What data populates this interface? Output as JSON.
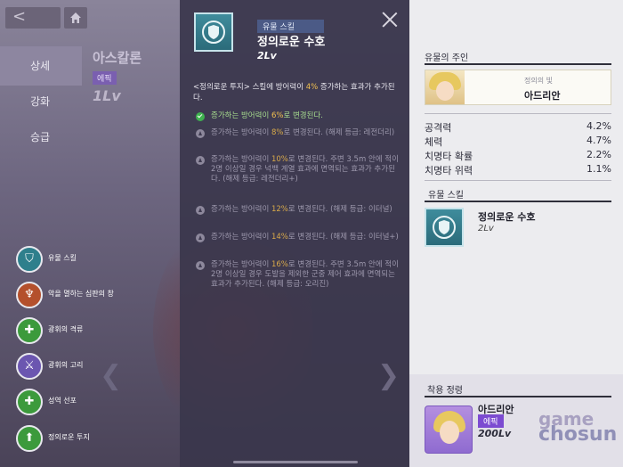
{
  "top": {
    "back_glyph": "<"
  },
  "left_nav": {
    "tabs": [
      {
        "label": "상세"
      },
      {
        "label": "강화"
      },
      {
        "label": "승급"
      }
    ]
  },
  "hero": {
    "name": "아스칼론",
    "grade": "에픽",
    "level": "1Lv"
  },
  "skill_menu": [
    {
      "label": "유물 스킬",
      "icon": "shield-icon",
      "color": "#2e7f8c"
    },
    {
      "label": "악을 멸하는 심판의 창",
      "icon": "spear-icon",
      "color": "#b4502c"
    },
    {
      "label": "광휘의 격류",
      "icon": "plus-icon",
      "color": "#3c9a3c"
    },
    {
      "label": "광휘의 고리",
      "icon": "sword-icon",
      "color": "#6b56b0"
    },
    {
      "label": "성역 선포",
      "icon": "plus-icon",
      "color": "#3c9a3c"
    },
    {
      "label": "정의로운 투지",
      "icon": "up-arrow-icon",
      "color": "#3c9a3c"
    }
  ],
  "panel": {
    "relic_type": "유물 스킬",
    "relic_name": "정의로운 수호",
    "relic_level": "2Lv",
    "desc_prefix": "<정의로운 투지> 스킬에 방어력이 ",
    "desc_value": "4%",
    "desc_suffix": " 증가하는 효과가 추가된다.",
    "levels": [
      {
        "pre": "증가하는 방어력이 ",
        "val": "6%",
        "post": "로 변경된다.",
        "active": true
      },
      {
        "pre": "증가하는 방어력이 ",
        "val": "8%",
        "post": "로 변경된다. (해제 등급: 레전더리)",
        "active": false
      },
      {
        "pre": "증가하는 방어력이 ",
        "val": "10%",
        "post": "로 변경된다. 주변 3.5m 안에 적이 2명 이상일 경우 넉백 계열 효과에 면역되는 효과가 추가된다. (해제 등급: 레전더리+)",
        "active": false
      },
      {
        "pre": "증가하는 방어력이 ",
        "val": "12%",
        "post": "로 변경된다. (해제 등급: 이터널)",
        "active": false
      },
      {
        "pre": "증가하는 방어력이 ",
        "val": "14%",
        "post": "로 변경된다. (해제 등급: 이터널+)",
        "active": false
      },
      {
        "pre": "증가하는 방어력이 ",
        "val": "16%",
        "post": "로 변경된다. 주변 3.5m 안에 적이 2명 이상일 경우 도발을 제외한 군중 제어 효과에 면역되는 효과가 추가된다. (해제 등급: 오리진)",
        "active": false
      }
    ]
  },
  "right": {
    "owner_heading": "유물의 주인",
    "owner_title": "정의의 빛",
    "owner_name": "아드리안",
    "stats": [
      {
        "label": "공격력",
        "value": "4.2%"
      },
      {
        "label": "체력",
        "value": "4.7%"
      },
      {
        "label": "치명타 확률",
        "value": "2.2%"
      },
      {
        "label": "치명타 위력",
        "value": "1.1%"
      }
    ],
    "skill_heading": "유물 스킬",
    "skill_name": "정의로운 수호",
    "skill_level": "2Lv",
    "sprite_heading": "착용 정령",
    "sprite_name": "아드리안",
    "sprite_grade": "에픽",
    "sprite_level": "200Lv"
  },
  "watermark": {
    "line1": "game",
    "line2": "chosun"
  },
  "colors": {
    "highlight": "#f2c04f",
    "active_green": "#3fb24f",
    "panel_bg": "#3e3a50",
    "right_bg": "#ececef"
  }
}
